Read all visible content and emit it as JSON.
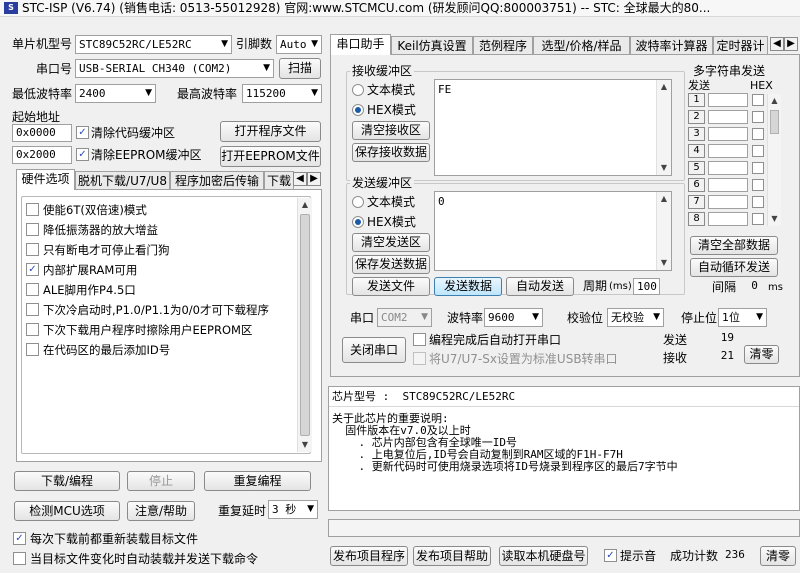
{
  "window": {
    "title": "STC-ISP (V6.74) (销售电话: 0513-55012928) 官网:www.STCMCU.com  (研发顾问QQ:800003751)  -- STC: 全球最大的80..."
  },
  "left": {
    "mcu_label": "单片机型号",
    "mcu_value": "STC89C52RC/LE52RC",
    "pin_label": "引脚数",
    "pin_value": "Auto",
    "port_label": "串口号",
    "port_value": "USB-SERIAL CH340 (COM2)",
    "scan": "扫描",
    "minbaud_label": "最低波特率",
    "minbaud_value": "2400",
    "maxbaud_label": "最高波特率",
    "maxbaud_value": "115200",
    "start_label": "起始地址",
    "addr1": "0x0000",
    "clear_code": "清除代码缓冲区",
    "open_prog": "打开程序文件",
    "addr2": "0x2000",
    "clear_eeprom": "清除EEPROM缓冲区",
    "open_eeprom": "打开EEPROM文件",
    "tabs": [
      "硬件选项",
      "脱机下载/U7/U8",
      "程序加密后传输",
      "下载"
    ],
    "options": [
      {
        "label": "使能6T(双倍速)模式",
        "checked": false
      },
      {
        "label": "降低振荡器的放大增益",
        "checked": false
      },
      {
        "label": "只有断电才可停止看门狗",
        "checked": false
      },
      {
        "label": "内部扩展RAM可用",
        "checked": true
      },
      {
        "label": "ALE脚用作P4.5口",
        "checked": false
      },
      {
        "label": "下次冷启动时,P1.0/P1.1为0/0才可下载程序",
        "checked": false
      },
      {
        "label": "下次下载用户程序时擦除用户EEPROM区",
        "checked": false
      },
      {
        "label": "在代码区的最后添加ID号",
        "checked": false
      }
    ],
    "download": "下载/编程",
    "stop": "停止",
    "reprogram": "重复编程",
    "detect": "检测MCU选项",
    "help": "注意/帮助",
    "delay_label": "重复延时",
    "delay_value": "3 秒",
    "reload_each": "每次下载前都重新装载目标文件",
    "auto_reload": "当目标文件变化时自动装载并发送下载命令"
  },
  "right": {
    "tabs": [
      "串口助手",
      "Keil仿真设置",
      "范例程序",
      "选型/价格/样品",
      "波特率计算器",
      "定时器计"
    ],
    "recv_group": "接收缓冲区",
    "recv_text": "文本模式",
    "recv_hex": "HEX模式",
    "recv_clear": "清空接收区",
    "recv_save": "保存接收数据",
    "recv_data": "FE",
    "send_group": "发送缓冲区",
    "send_text": "文本模式",
    "send_hex": "HEX模式",
    "send_clear": "清空发送区",
    "send_save": "保存发送数据",
    "send_data": "0",
    "send_file": "发送文件",
    "send_data_btn": "发送数据",
    "auto_send": "自动发送",
    "period_label": "周期",
    "period_unit": "(ms)",
    "period_value": "100",
    "multi_title": "多字符串发送",
    "multi_send": "发送",
    "multi_hex": "HEX",
    "multi_nums": [
      "1",
      "2",
      "3",
      "4",
      "5",
      "6",
      "7",
      "8"
    ],
    "clear_all": "清空全部数据",
    "auto_loop": "自动循环发送",
    "interval_label": "间隔",
    "interval_value": "0",
    "interval_unit": "ms",
    "com_label": "串口",
    "com_value": "COM2",
    "baud_label": "波特率",
    "baud_value": "9600",
    "parity_label": "校验位",
    "parity_value": "无校验",
    "stop_label": "停止位",
    "stop_value": "1位",
    "close_port": "关闭串口",
    "open_after": "编程完成后自动打开串口",
    "set_usb": "将U7/U7-Sx设置为标准USB转串口",
    "sent_label": "发送",
    "sent_value": "19",
    "recv_label": "接收",
    "recv_value": "21",
    "clear_count": "清零",
    "chip_line": "芯片型号 :  STC89C52RC/LE52RC",
    "notes": [
      "关于此芯片的重要说明:",
      "  固件版本在v7.0及以上时",
      "    . 芯片内部包含有全球唯一ID号",
      "    . 上电复位后,ID号会自动复制到RAM区域的F1H-F7H",
      "    . 更新代码时可使用烧录选项将ID号烧录到程序区的最后7字节中"
    ],
    "publish_prog": "发布项目程序",
    "publish_help": "发布项目帮助",
    "read_serial": "读取本机硬盘号",
    "prompt_sound": "提示音",
    "success_label": "成功计数",
    "success_value": "236",
    "clear_success": "清零"
  }
}
